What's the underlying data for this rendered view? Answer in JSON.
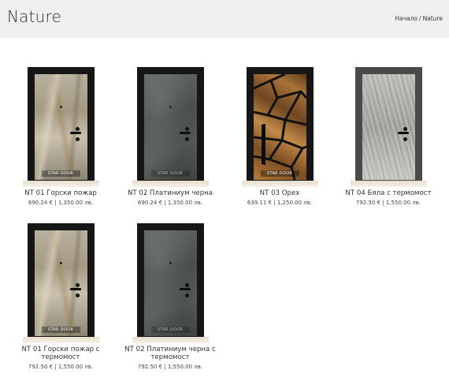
{
  "header": {
    "title": "Nature",
    "breadcrumb": {
      "home": "Начало",
      "separator": "/",
      "current": "Nature"
    }
  },
  "products": [
    {
      "name": "NT 01 Горски пожар",
      "price": "690.24 € | 1,350.00 лв.",
      "finish": "marble",
      "brand": "STAR DOOR"
    },
    {
      "name": "NT 02 Платиниум черна",
      "price": "690.24 € | 1,350.00 лв.",
      "finish": "slate",
      "brand": "STAR DOOR"
    },
    {
      "name": "NT 03 Орех",
      "price": "639.11 € | 1,250.00 лв.",
      "finish": "walnut",
      "brand": "STAR DOOR"
    },
    {
      "name": "NT 04 Бяла с термомост",
      "price": "792.50 € | 1,550.00 лв.",
      "finish": "oak-white",
      "brand": ""
    },
    {
      "name": "NT 01 Горски пожар с термомост",
      "price": "792.50 € | 1,550.00 лв.",
      "finish": "marble",
      "brand": "STAR DOOR"
    },
    {
      "name": "NT 02 Платиниум черна с термомост",
      "price": "792.50 € | 1,550.00 лв.",
      "finish": "slate",
      "brand": "STAR DOOR"
    }
  ]
}
